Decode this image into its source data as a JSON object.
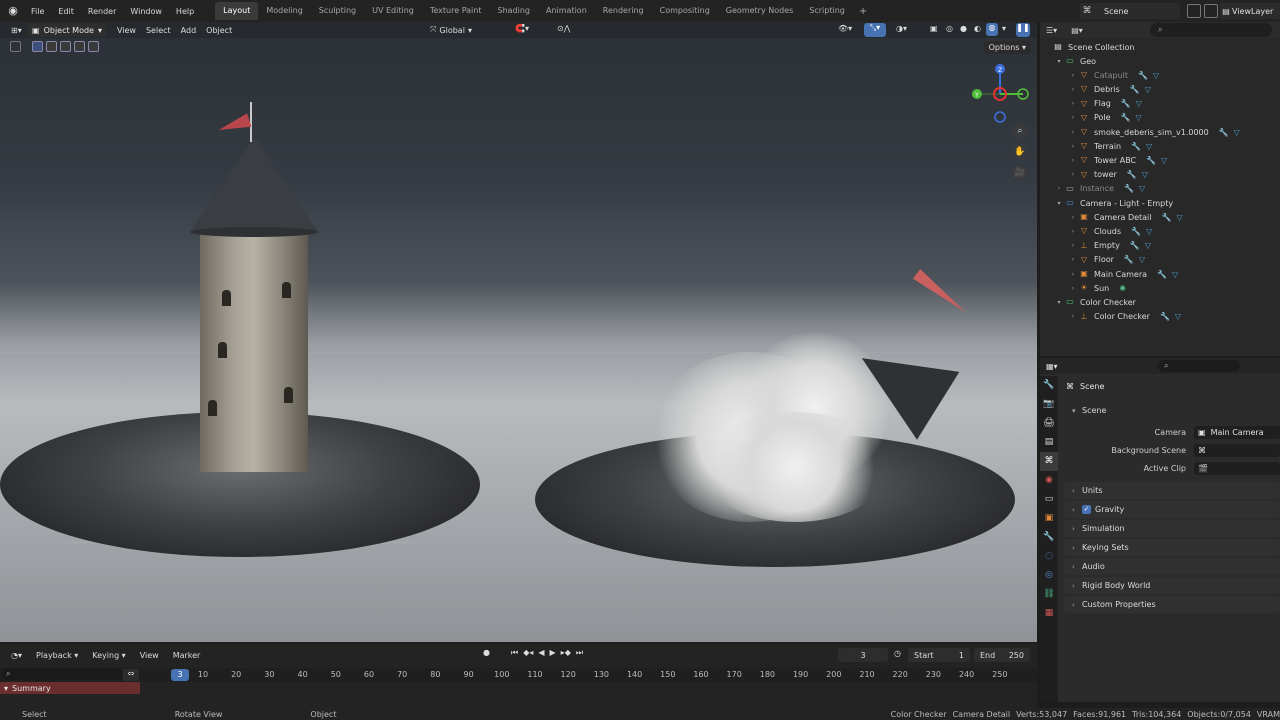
{
  "menu": [
    "File",
    "Edit",
    "Render",
    "Window",
    "Help"
  ],
  "workspaces": [
    "Layout",
    "Modeling",
    "Sculpting",
    "UV Editing",
    "Texture Paint",
    "Shading",
    "Animation",
    "Rendering",
    "Compositing",
    "Geometry Nodes",
    "Scripting"
  ],
  "active_workspace": "Layout",
  "scene_name": "Scene",
  "view_layer": "ViewLayer",
  "viewport": {
    "mode": "Object Mode",
    "menus": [
      "View",
      "Select",
      "Add",
      "Object"
    ],
    "transform_orientation": "Global",
    "options_label": "Options",
    "gizmo_axes": {
      "x": "X",
      "y": "Y",
      "z": "Z"
    }
  },
  "outliner": {
    "search_placeholder": "",
    "root": "Scene Collection",
    "rows": [
      {
        "label": "Geo",
        "type": "collection",
        "indent": 1,
        "expanded": true
      },
      {
        "label": "Catapult",
        "type": "object",
        "indent": 2,
        "dim": true
      },
      {
        "label": "Debris",
        "type": "object",
        "indent": 2
      },
      {
        "label": "Flag",
        "type": "object",
        "indent": 2
      },
      {
        "label": "Pole",
        "type": "object",
        "indent": 2
      },
      {
        "label": "smoke_deberis_sim_v1.0000",
        "type": "object",
        "indent": 2
      },
      {
        "label": "Terrain",
        "type": "object",
        "indent": 2
      },
      {
        "label": "Tower ABC",
        "type": "object",
        "indent": 2
      },
      {
        "label": "tower",
        "type": "object",
        "indent": 2
      },
      {
        "label": "Instance",
        "type": "collection",
        "indent": 1,
        "dim": true
      },
      {
        "label": "Camera - Light - Empty",
        "type": "collection",
        "indent": 1,
        "expanded": true
      },
      {
        "label": "Camera Detail",
        "type": "camera",
        "indent": 2
      },
      {
        "label": "Clouds",
        "type": "object",
        "indent": 2
      },
      {
        "label": "Empty",
        "type": "empty",
        "indent": 2
      },
      {
        "label": "Floor",
        "type": "object",
        "indent": 2
      },
      {
        "label": "Main Camera",
        "type": "camera",
        "indent": 2
      },
      {
        "label": "Sun",
        "type": "light",
        "indent": 2
      },
      {
        "label": "Color Checker",
        "type": "collection",
        "indent": 1,
        "expanded": true
      },
      {
        "label": "Color Checker",
        "type": "empty",
        "indent": 2
      }
    ]
  },
  "properties": {
    "title": "Scene",
    "scene_panel": "Scene",
    "fields": [
      {
        "label": "Camera",
        "value": "Main Camera"
      },
      {
        "label": "Background Scene",
        "value": ""
      },
      {
        "label": "Active Clip",
        "value": ""
      }
    ],
    "panels": [
      "Units",
      "Gravity",
      "Simulation",
      "Keying Sets",
      "Audio",
      "Rigid Body World",
      "Custom Properties"
    ],
    "gravity_checked": true
  },
  "timeline": {
    "menus": [
      "Playback",
      "Keying",
      "View",
      "Marker"
    ],
    "current_frame": "3",
    "start_label": "Start",
    "start": "1",
    "end_label": "End",
    "end": "250",
    "ticks": [
      "10",
      "20",
      "30",
      "40",
      "50",
      "60",
      "70",
      "80",
      "90",
      "100",
      "110",
      "120",
      "130",
      "140",
      "150",
      "160",
      "170",
      "180",
      "190",
      "200",
      "210",
      "220",
      "230",
      "240",
      "250"
    ],
    "summary": "Summary"
  },
  "statusbar": {
    "hints": [
      "Select",
      "Rotate View",
      "Object"
    ],
    "stats": [
      "Color Checker",
      "Camera Detail",
      "Verts:53,047",
      "Faces:91,961",
      "Tris:104,364",
      "Objects:0/7,054",
      "VRAM"
    ]
  },
  "colors": {
    "accent": "#4772b3",
    "collection": "#e3e3e3",
    "object": "#e08a3a"
  }
}
